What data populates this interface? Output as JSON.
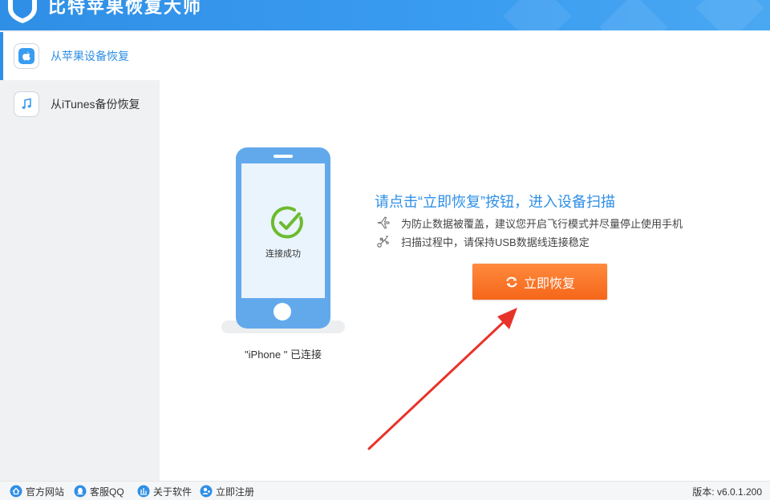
{
  "app": {
    "title": "比特苹果恢复大师",
    "accent_color": "#2f8fe6",
    "button_color": "#f5661a"
  },
  "sidebar": {
    "items": [
      {
        "label": "从苹果设备恢复",
        "icon": "apple-icon",
        "active": true
      },
      {
        "label": "从iTunes备份恢复",
        "icon": "music-note-icon",
        "active": false
      }
    ]
  },
  "main": {
    "phone_status": "连接成功",
    "device_caption": "\"iPhone \" 已连接",
    "heading": "请点击“立即恢复”按钮，进入设备扫描",
    "tips": [
      {
        "icon": "airplane-icon",
        "text": "为防止数据被覆盖，建议您开启飞行模式并尽量停止使用手机"
      },
      {
        "icon": "usb-icon",
        "text": "扫描过程中，请保持USB数据线连接稳定"
      }
    ],
    "recover_button": "立即恢复"
  },
  "footer": {
    "links": [
      {
        "label": "官方网站",
        "icon": "home-icon"
      },
      {
        "label": "客服QQ",
        "icon": "qq-icon"
      },
      {
        "label": "关于软件",
        "icon": "info-icon"
      },
      {
        "label": "立即注册",
        "icon": "register-icon"
      }
    ],
    "version": "版本: v6.0.1.200"
  }
}
